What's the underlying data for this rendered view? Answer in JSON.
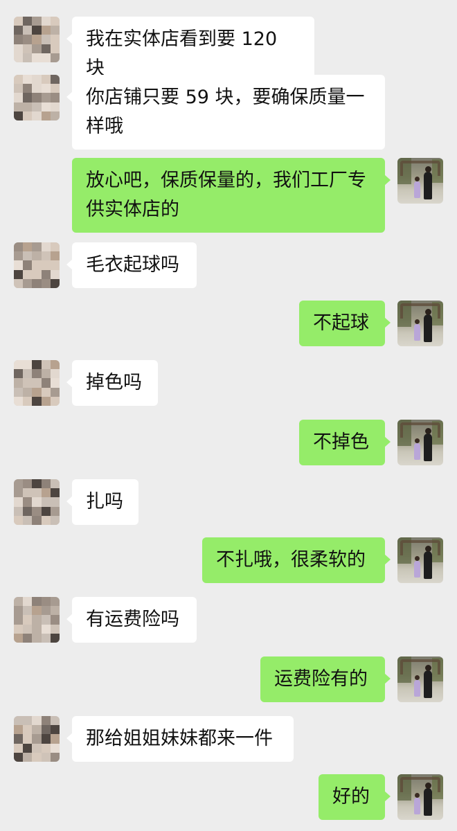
{
  "colors": {
    "background": "#ededed",
    "incoming_bubble": "#ffffff",
    "outgoing_bubble": "#95ec69",
    "text": "#111111"
  },
  "avatars": {
    "other": "pixelated-avatar",
    "self": "photo-avatar"
  },
  "messages": [
    {
      "side": "left",
      "text": "我在实体店看到要 120 块"
    },
    {
      "side": "left",
      "text": "你店铺只要 59 块，要确保质量一样哦"
    },
    {
      "side": "right",
      "text": "放心吧，保质保量的，我们工厂专供实体店的"
    },
    {
      "side": "left",
      "text": "毛衣起球吗"
    },
    {
      "side": "right",
      "text": "不起球"
    },
    {
      "side": "left",
      "text": "掉色吗"
    },
    {
      "side": "right",
      "text": "不掉色"
    },
    {
      "side": "left",
      "text": "扎吗"
    },
    {
      "side": "right",
      "text": "不扎哦，很柔软的"
    },
    {
      "side": "left",
      "text": "有运费险吗"
    },
    {
      "side": "right",
      "text": "运费险有的"
    },
    {
      "side": "left",
      "text": "那给姐姐妹妹都来一件"
    },
    {
      "side": "right",
      "text": "好的"
    }
  ]
}
